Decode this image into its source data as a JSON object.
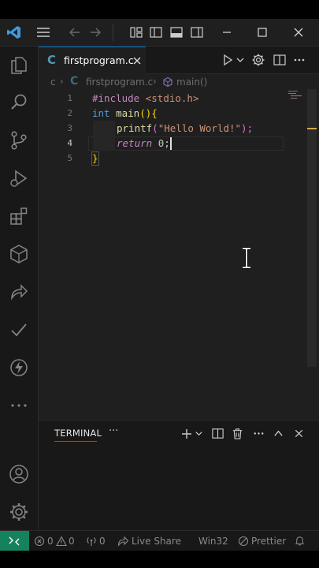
{
  "tab": {
    "icon_letter": "C",
    "filename": "firstprogram.c"
  },
  "breadcrumb": {
    "folder": "c",
    "file_icon_letter": "C",
    "file": "firstprogram.c",
    "symbol": "main()"
  },
  "code": {
    "line_numbers": [
      "1",
      "2",
      "3",
      "4",
      "5"
    ],
    "line1": {
      "directive": "#include",
      "header": "<stdio.h>"
    },
    "line2": {
      "type": "int",
      "func": "main",
      "paren": "(){"
    },
    "line3": {
      "func": "printf",
      "open": "(",
      "string": "\"Hello World!\"",
      "close": ");"
    },
    "line4": {
      "keyword": "return",
      "number": "0",
      "semi": ";"
    },
    "line5": {
      "brace": "}"
    }
  },
  "panel": {
    "terminal_tab": "TERMINAL",
    "more": "···"
  },
  "status": {
    "errors": "0",
    "warnings": "0",
    "ports": "0",
    "live_share": "Live Share",
    "platform": "Win32",
    "prettier": "Prettier"
  },
  "colors": {
    "accent": "#0078d4",
    "remote_button": "#16825d",
    "c_icon": "#519aba",
    "keyword": "#c586c0",
    "type": "#569cd6",
    "function": "#dcdcaa",
    "string": "#ce9178",
    "number": "#b5cea8",
    "bracket_gold": "#ffd700",
    "bracket_pink": "#da70d6"
  }
}
